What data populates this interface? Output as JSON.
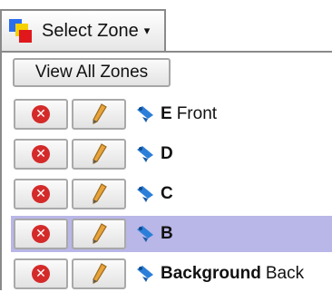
{
  "select_zone": {
    "label": "Select Zone",
    "caret": "▾",
    "icon": "zones-icon"
  },
  "view_all": {
    "label": "View All Zones"
  },
  "zones": [
    {
      "name": "E",
      "description": "Front",
      "selected": false
    },
    {
      "name": "D",
      "description": "",
      "selected": false
    },
    {
      "name": "C",
      "description": "",
      "selected": false
    },
    {
      "name": "B",
      "description": "",
      "selected": true
    },
    {
      "name": "Background",
      "description": "Back",
      "selected": false
    }
  ],
  "icons": {
    "delete": "delete-icon",
    "edit": "pencil-icon",
    "zone": "zone-pin-icon"
  },
  "colors": {
    "selected_row": "#b9b6e8",
    "delete": "#d42a2a"
  }
}
